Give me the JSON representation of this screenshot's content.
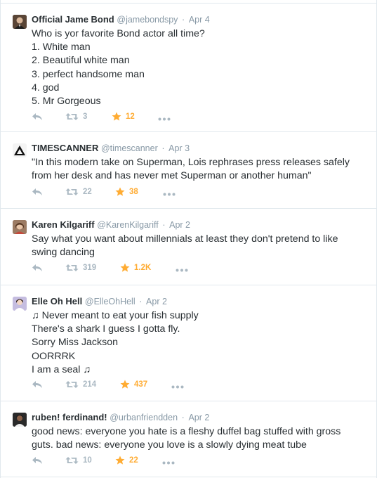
{
  "tweets": [
    {
      "name": "Official Jame Bond",
      "handle": "@jamebondspy",
      "date": "Apr 4",
      "lines": [
        "Who is yor favorite Bond actor all time?",
        "1. White man",
        "2. Beautiful white man",
        "3. perfect handsome man",
        "4. god",
        "5. Mr Gorgeous"
      ],
      "retweets": "3",
      "favorites": "12"
    },
    {
      "name": "TIMESCANNER",
      "handle": "@timescanner",
      "date": "Apr 3",
      "lines": [
        "\"In this modern take on Superman, Lois rephrases press releases safely",
        "from her desk and has never met Superman or another human\""
      ],
      "retweets": "22",
      "favorites": "38"
    },
    {
      "name": "Karen Kilgariff",
      "handle": "@KarenKilgariff",
      "date": "Apr 2",
      "lines": [
        "Say what you want about millennials at least they don't pretend to like",
        "swing dancing"
      ],
      "retweets": "319",
      "favorites": "1.2K"
    },
    {
      "name": "Elle Oh Hell",
      "handle": "@ElleOhHell",
      "date": "Apr 2",
      "lines": [
        "♫ Never meant to eat your fish supply",
        "There's a shark I guess I gotta fly.",
        "Sorry Miss Jackson",
        "OORRRK",
        "I am a seal ♫"
      ],
      "retweets": "214",
      "favorites": "437"
    },
    {
      "name": "ruben! ferdinand!",
      "handle": "@urbanfriendden",
      "date": "Apr 2",
      "lines": [
        "good news: everyone you hate is a fleshy duffel bag stuffed with gross",
        "guts. bad news: everyone you love is a slowly dying meat tube"
      ],
      "retweets": "10",
      "favorites": "22"
    }
  ],
  "separator": "·",
  "icons": {
    "reply": "reply-icon",
    "retweet": "retweet-icon",
    "favorite": "star-icon",
    "more": "more-dots-icon"
  },
  "colors": {
    "text": "#292f33",
    "muted": "#8899a6",
    "action": "#aab8c2",
    "favorite": "#ffac33",
    "border": "#e1e8ed"
  }
}
